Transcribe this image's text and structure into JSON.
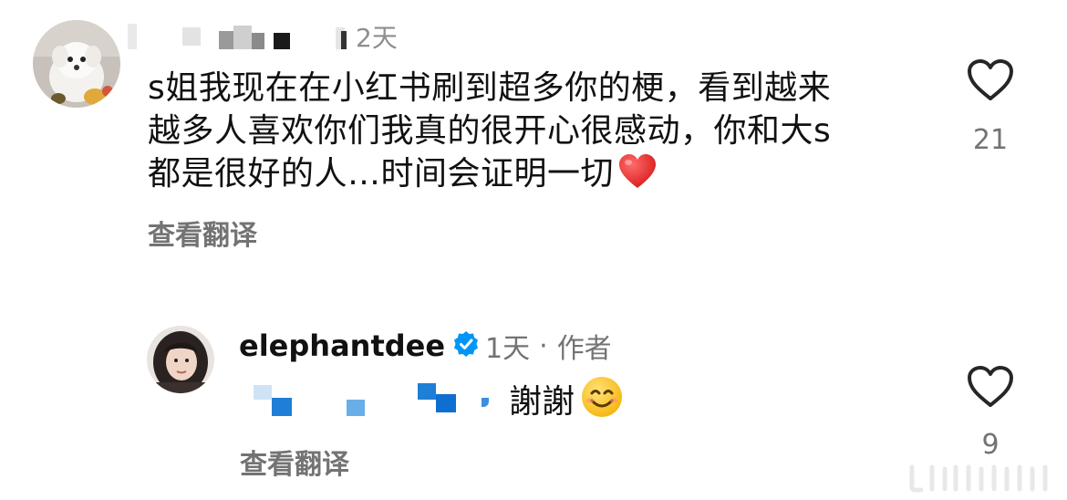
{
  "comments": [
    {
      "username_censored": true,
      "time": "2天",
      "text_lines": [
        "s姐我现在在小红书刷到超多你的梗，看到越来",
        "越多人喜欢你们我真的很开心很感动，你和大s",
        "都是很好的人…时间会证明一切"
      ],
      "emoji": "heart",
      "translate_label": "查看翻译",
      "like_count": "21",
      "avatar": "white-dog-avatar"
    },
    {
      "username": "elephantdee",
      "verified": true,
      "time": "1天",
      "separator": "·",
      "author_label": "作者",
      "reply_text": "謝謝",
      "emoji": "smiling-face",
      "translate_label": "查看翻译",
      "like_count": "9",
      "avatar": "woman-avatar"
    }
  ],
  "colors": {
    "text": "#111111",
    "secondary": "#737373",
    "verified_badge": "#0095f6",
    "heart_red": "#e53935"
  }
}
